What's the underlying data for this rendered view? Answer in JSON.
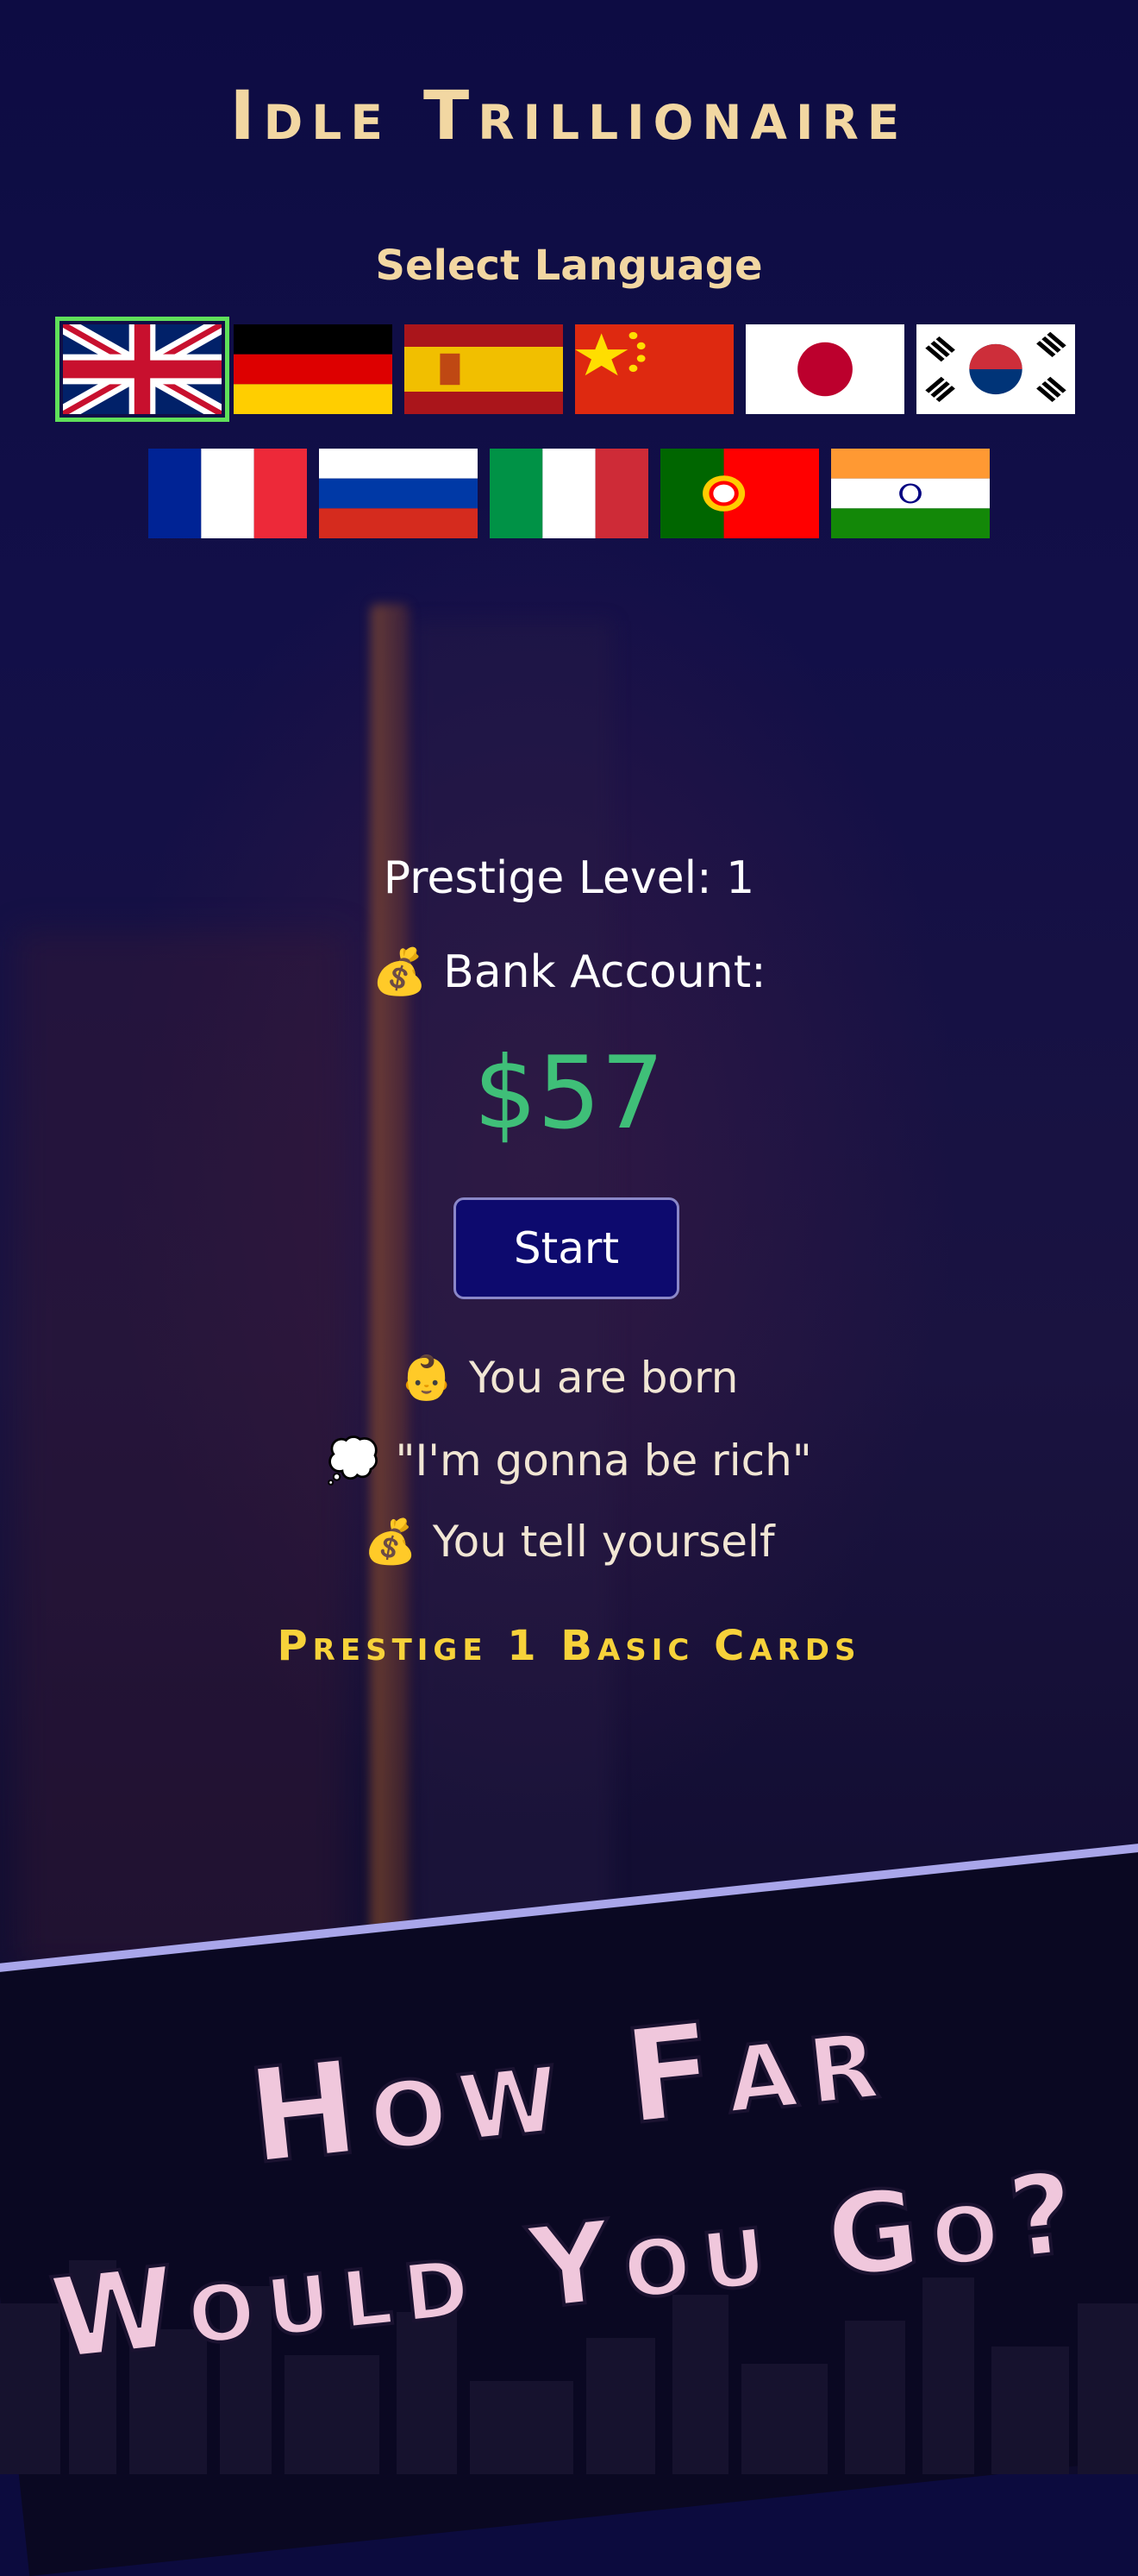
{
  "app": {
    "title": "Idle Trillionaire"
  },
  "language": {
    "label": "Select Language",
    "flags": [
      {
        "name": "flag-uk",
        "selected": true
      },
      {
        "name": "flag-germany",
        "selected": false
      },
      {
        "name": "flag-spain",
        "selected": false
      },
      {
        "name": "flag-china",
        "selected": false
      },
      {
        "name": "flag-japan",
        "selected": false
      },
      {
        "name": "flag-korea",
        "selected": false
      },
      {
        "name": "flag-france",
        "selected": false
      },
      {
        "name": "flag-russia",
        "selected": false
      },
      {
        "name": "flag-italy",
        "selected": false
      },
      {
        "name": "flag-portugal",
        "selected": false
      },
      {
        "name": "flag-india",
        "selected": false
      }
    ]
  },
  "stats": {
    "prestige_level": "Prestige Level: 1",
    "bank_emoji": "💰",
    "bank_label": "Bank Account:",
    "bank_value": "$57"
  },
  "actions": {
    "start_label": "Start"
  },
  "story": {
    "line1_emoji": "👶",
    "line1": "You are born",
    "line2_emoji": "💭",
    "line2": "\"I'm gonna be rich\"",
    "line3_emoji": "💰",
    "line3": "You tell yourself"
  },
  "cards_heading": "Prestige 1  Basic Cards",
  "promo": {
    "line1": "How Far",
    "line2": "Would You Go?"
  },
  "colors": {
    "background": "#0c0b3e",
    "title": "#f2d7a2",
    "money": "#3fbf78",
    "heading_yellow": "#f7d23a",
    "button_bg": "#0d0a6e",
    "selected_outline": "#5fe05a",
    "slogan": "#f0c7dc"
  }
}
